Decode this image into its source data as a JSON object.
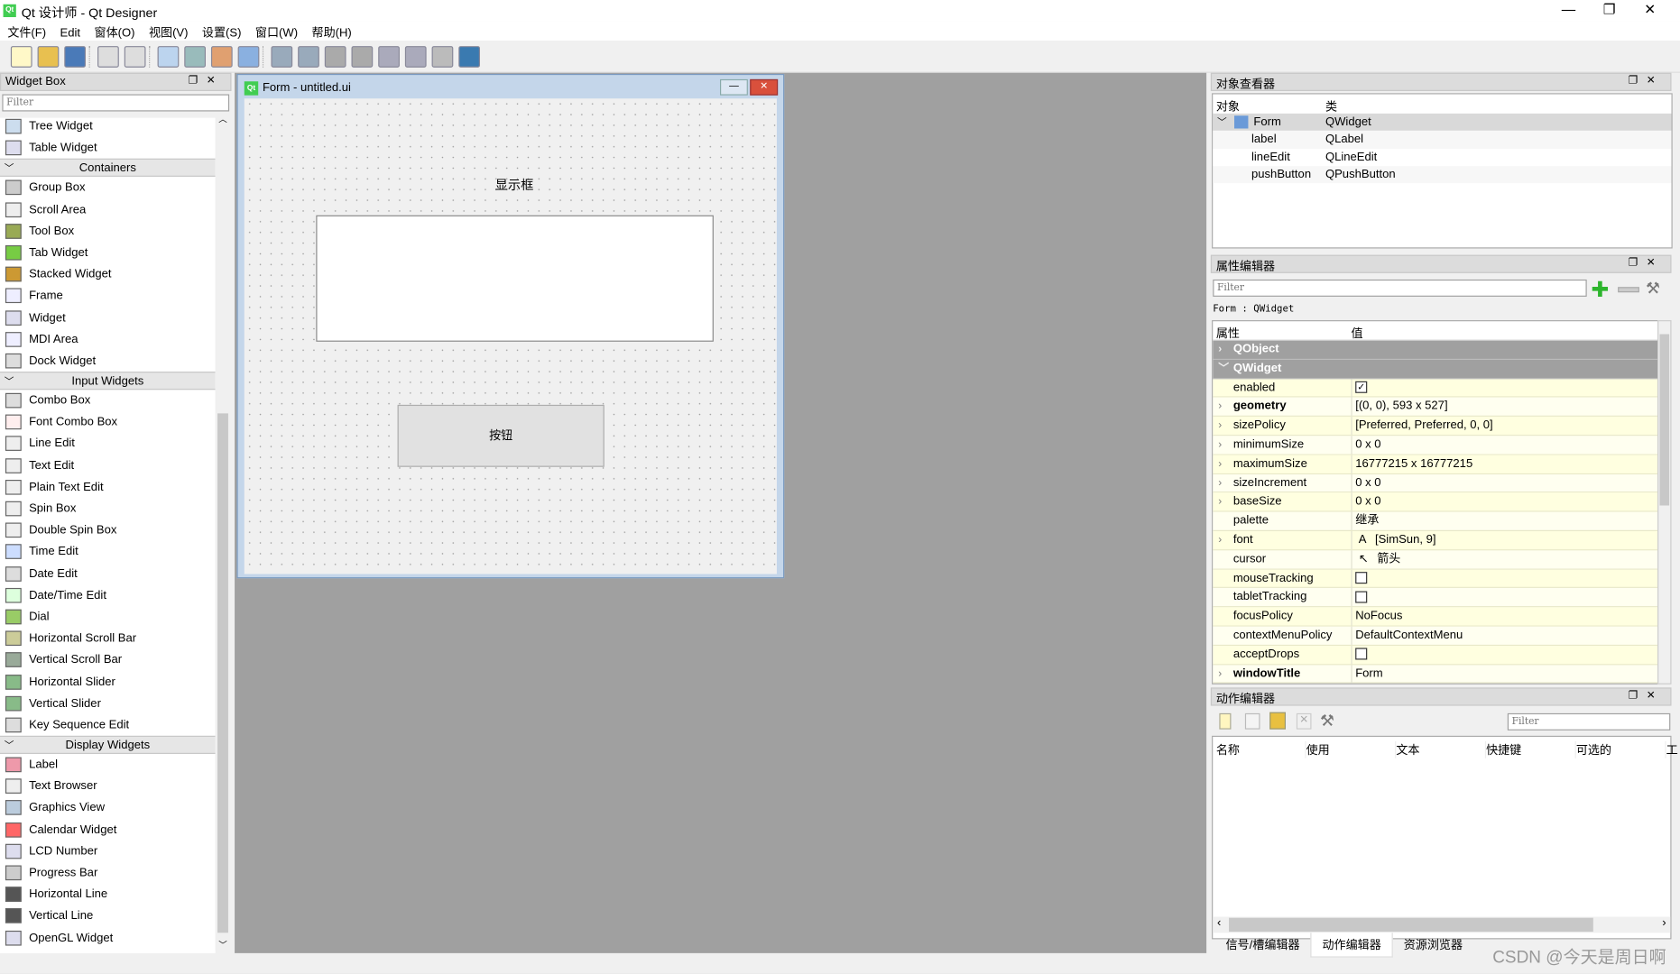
{
  "window": {
    "title": "Qt 设计师 - Qt Designer",
    "app_icon": "Qt",
    "minimize": "—",
    "restore": "❐",
    "close": "✕"
  },
  "menu": [
    "文件(F)",
    "Edit",
    "窗体(O)",
    "视图(V)",
    "设置(S)",
    "窗口(W)",
    "帮助(H)"
  ],
  "toolbar_icons": [
    "new-file-icon",
    "open-file-icon",
    "save-icon",
    "send-to-back-icon",
    "bring-to-front-icon",
    "edit-widgets-icon",
    "edit-signals-slots-icon",
    "edit-buddies-icon",
    "edit-tab-order-icon",
    "layout-horizontal-icon",
    "layout-vertical-icon",
    "layout-horizontal-splitter-icon",
    "layout-vertical-splitter-icon",
    "layout-grid-icon",
    "layout-form-icon",
    "break-layout-icon",
    "adjust-size-icon"
  ],
  "widget_box": {
    "title": "Widget Box",
    "filter_placeholder": "Filter",
    "groups": [
      {
        "label": "",
        "items": [
          "Tree Widget",
          "Table Widget"
        ]
      },
      {
        "label": "Containers",
        "items": [
          "Group Box",
          "Scroll Area",
          "Tool Box",
          "Tab Widget",
          "Stacked Widget",
          "Frame",
          "Widget",
          "MDI Area",
          "Dock Widget"
        ]
      },
      {
        "label": "Input Widgets",
        "items": [
          "Combo Box",
          "Font Combo Box",
          "Line Edit",
          "Text Edit",
          "Plain Text Edit",
          "Spin Box",
          "Double Spin Box",
          "Time Edit",
          "Date Edit",
          "Date/Time Edit",
          "Dial",
          "Horizontal Scroll Bar",
          "Vertical Scroll Bar",
          "Horizontal Slider",
          "Vertical Slider",
          "Key Sequence Edit"
        ]
      },
      {
        "label": "Display Widgets",
        "items": [
          "Label",
          "Text Browser",
          "Graphics View",
          "Calendar Widget",
          "LCD Number",
          "Progress Bar",
          "Horizontal Line",
          "Vertical Line",
          "OpenGL Widget"
        ]
      }
    ]
  },
  "form": {
    "title": "Form - untitled.ui",
    "label_text": "显示框",
    "button_text": "按钮"
  },
  "object_inspector": {
    "title": "对象查看器",
    "col_object": "对象",
    "col_class": "类",
    "rows": [
      {
        "name": "Form",
        "cls": "QWidget"
      },
      {
        "name": "label",
        "cls": "QLabel"
      },
      {
        "name": "lineEdit",
        "cls": "QLineEdit"
      },
      {
        "name": "pushButton",
        "cls": "QPushButton"
      }
    ]
  },
  "property_editor": {
    "title": "属性编辑器",
    "filter_placeholder": "Filter",
    "context": "Form : QWidget",
    "col_prop": "属性",
    "col_value": "值",
    "sections": [
      {
        "label": "QObject",
        "expanded": false
      },
      {
        "label": "QWidget",
        "expanded": true
      }
    ],
    "rows": [
      {
        "name": "enabled",
        "value": "",
        "check": true,
        "bold": false,
        "exp": false
      },
      {
        "name": "geometry",
        "value": "[(0, 0), 593 x 527]",
        "bold": true,
        "exp": true
      },
      {
        "name": "sizePolicy",
        "value": "[Preferred, Preferred, 0, 0]",
        "exp": true
      },
      {
        "name": "minimumSize",
        "value": "0 x 0",
        "exp": true
      },
      {
        "name": "maximumSize",
        "value": "16777215 x 16777215",
        "exp": true
      },
      {
        "name": "sizeIncrement",
        "value": "0 x 0",
        "exp": true
      },
      {
        "name": "baseSize",
        "value": "0 x 0",
        "exp": true
      },
      {
        "name": "palette",
        "value": "继承"
      },
      {
        "name": "font",
        "value": "[SimSun, 9]",
        "prefix": "A",
        "exp": true
      },
      {
        "name": "cursor",
        "value": "箭头",
        "prefix": "↖"
      },
      {
        "name": "mouseTracking",
        "value": "",
        "check": false
      },
      {
        "name": "tabletTracking",
        "value": "",
        "check": false
      },
      {
        "name": "focusPolicy",
        "value": "NoFocus"
      },
      {
        "name": "contextMenuPolicy",
        "value": "DefaultContextMenu"
      },
      {
        "name": "acceptDrops",
        "value": "",
        "check": false
      },
      {
        "name": "windowTitle",
        "value": "Form",
        "bold": true,
        "exp": true
      }
    ]
  },
  "action_editor": {
    "title": "动作编辑器",
    "filter_placeholder": "Filter",
    "columns": [
      "名称",
      "使用",
      "文本",
      "快捷键",
      "可选的",
      "工"
    ]
  },
  "bottom_tabs": [
    "信号/槽编辑器",
    "动作编辑器",
    "资源浏览器"
  ],
  "watermark": "CSDN @今天是周日啊",
  "colors": {
    "property_row": "#ffffe0",
    "section_header": "#a0a0a0",
    "mdi_background": "#a0a0a0"
  }
}
